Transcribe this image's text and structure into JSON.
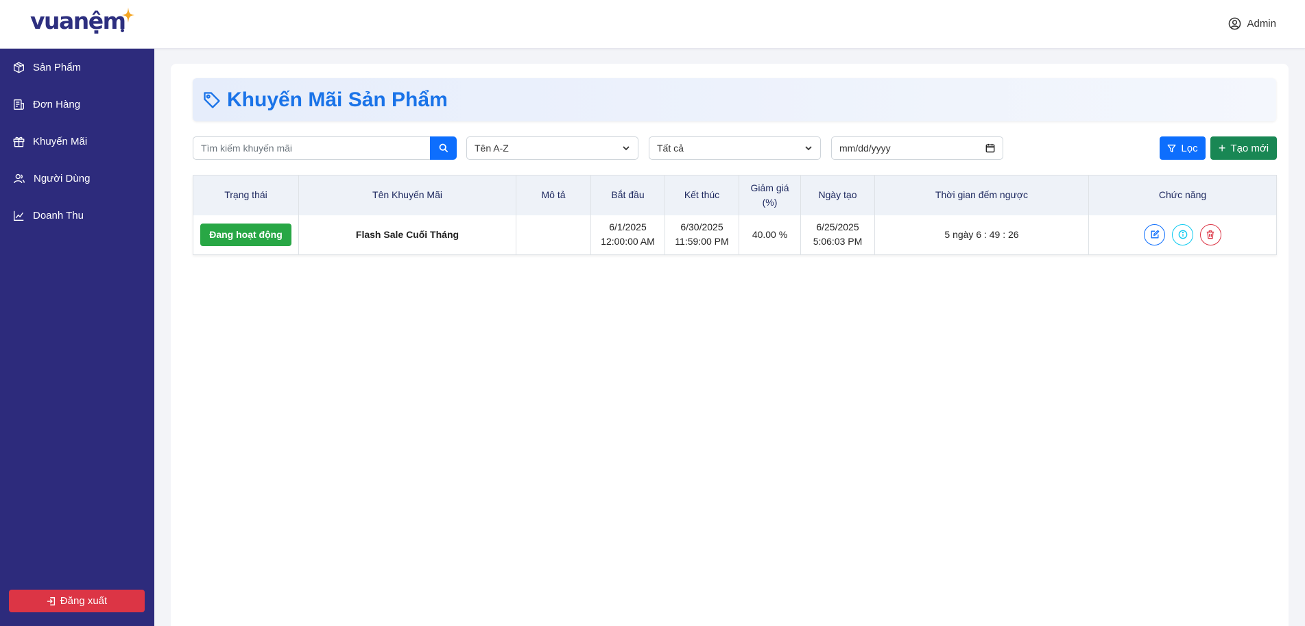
{
  "header": {
    "logo_text": "vuanệm",
    "user_name": "Admin"
  },
  "sidebar": {
    "items": [
      {
        "label": "Sản Phẩm",
        "icon": "box-icon"
      },
      {
        "label": "Đơn Hàng",
        "icon": "receipt-icon"
      },
      {
        "label": "Khuyến Mãi",
        "icon": "gift-icon"
      },
      {
        "label": "Người Dùng",
        "icon": "users-icon"
      },
      {
        "label": "Doanh Thu",
        "icon": "chart-line-icon"
      }
    ],
    "logout_label": "Đăng xuất"
  },
  "page": {
    "title": "Khuyến Mãi Sản Phẩm"
  },
  "toolbar": {
    "search_placeholder": "Tìm kiếm khuyến mãi",
    "sort_value": "Tên A-Z",
    "status_value": "Tất cả",
    "date_placeholder": "mm/dd/yyyy",
    "filter_label": "Lọc",
    "create_label": "Tạo mới"
  },
  "table": {
    "columns": [
      "Trạng thái",
      "Tên Khuyến Mãi",
      "Mô tả",
      "Bắt đầu",
      "Kết thúc",
      "Giảm giá (%)",
      "Ngày tạo",
      "Thời gian đếm ngược",
      "Chức năng"
    ],
    "rows": [
      {
        "status": "Đang hoạt động",
        "name": "Flash Sale Cuối Tháng",
        "description": "",
        "start_date": "6/1/2025",
        "start_time": "12:00:00 AM",
        "end_date": "6/30/2025",
        "end_time": "11:59:00 PM",
        "discount": "40.00 %",
        "created_date": "6/25/2025",
        "created_time": "5:06:03 PM",
        "countdown": "5 ngày 6 : 49 : 26"
      }
    ]
  },
  "colors": {
    "sidebar": "#2d2b7c",
    "primary": "#0d6efd",
    "success": "#198754",
    "danger": "#dc3545",
    "title": "#1a73e8"
  }
}
